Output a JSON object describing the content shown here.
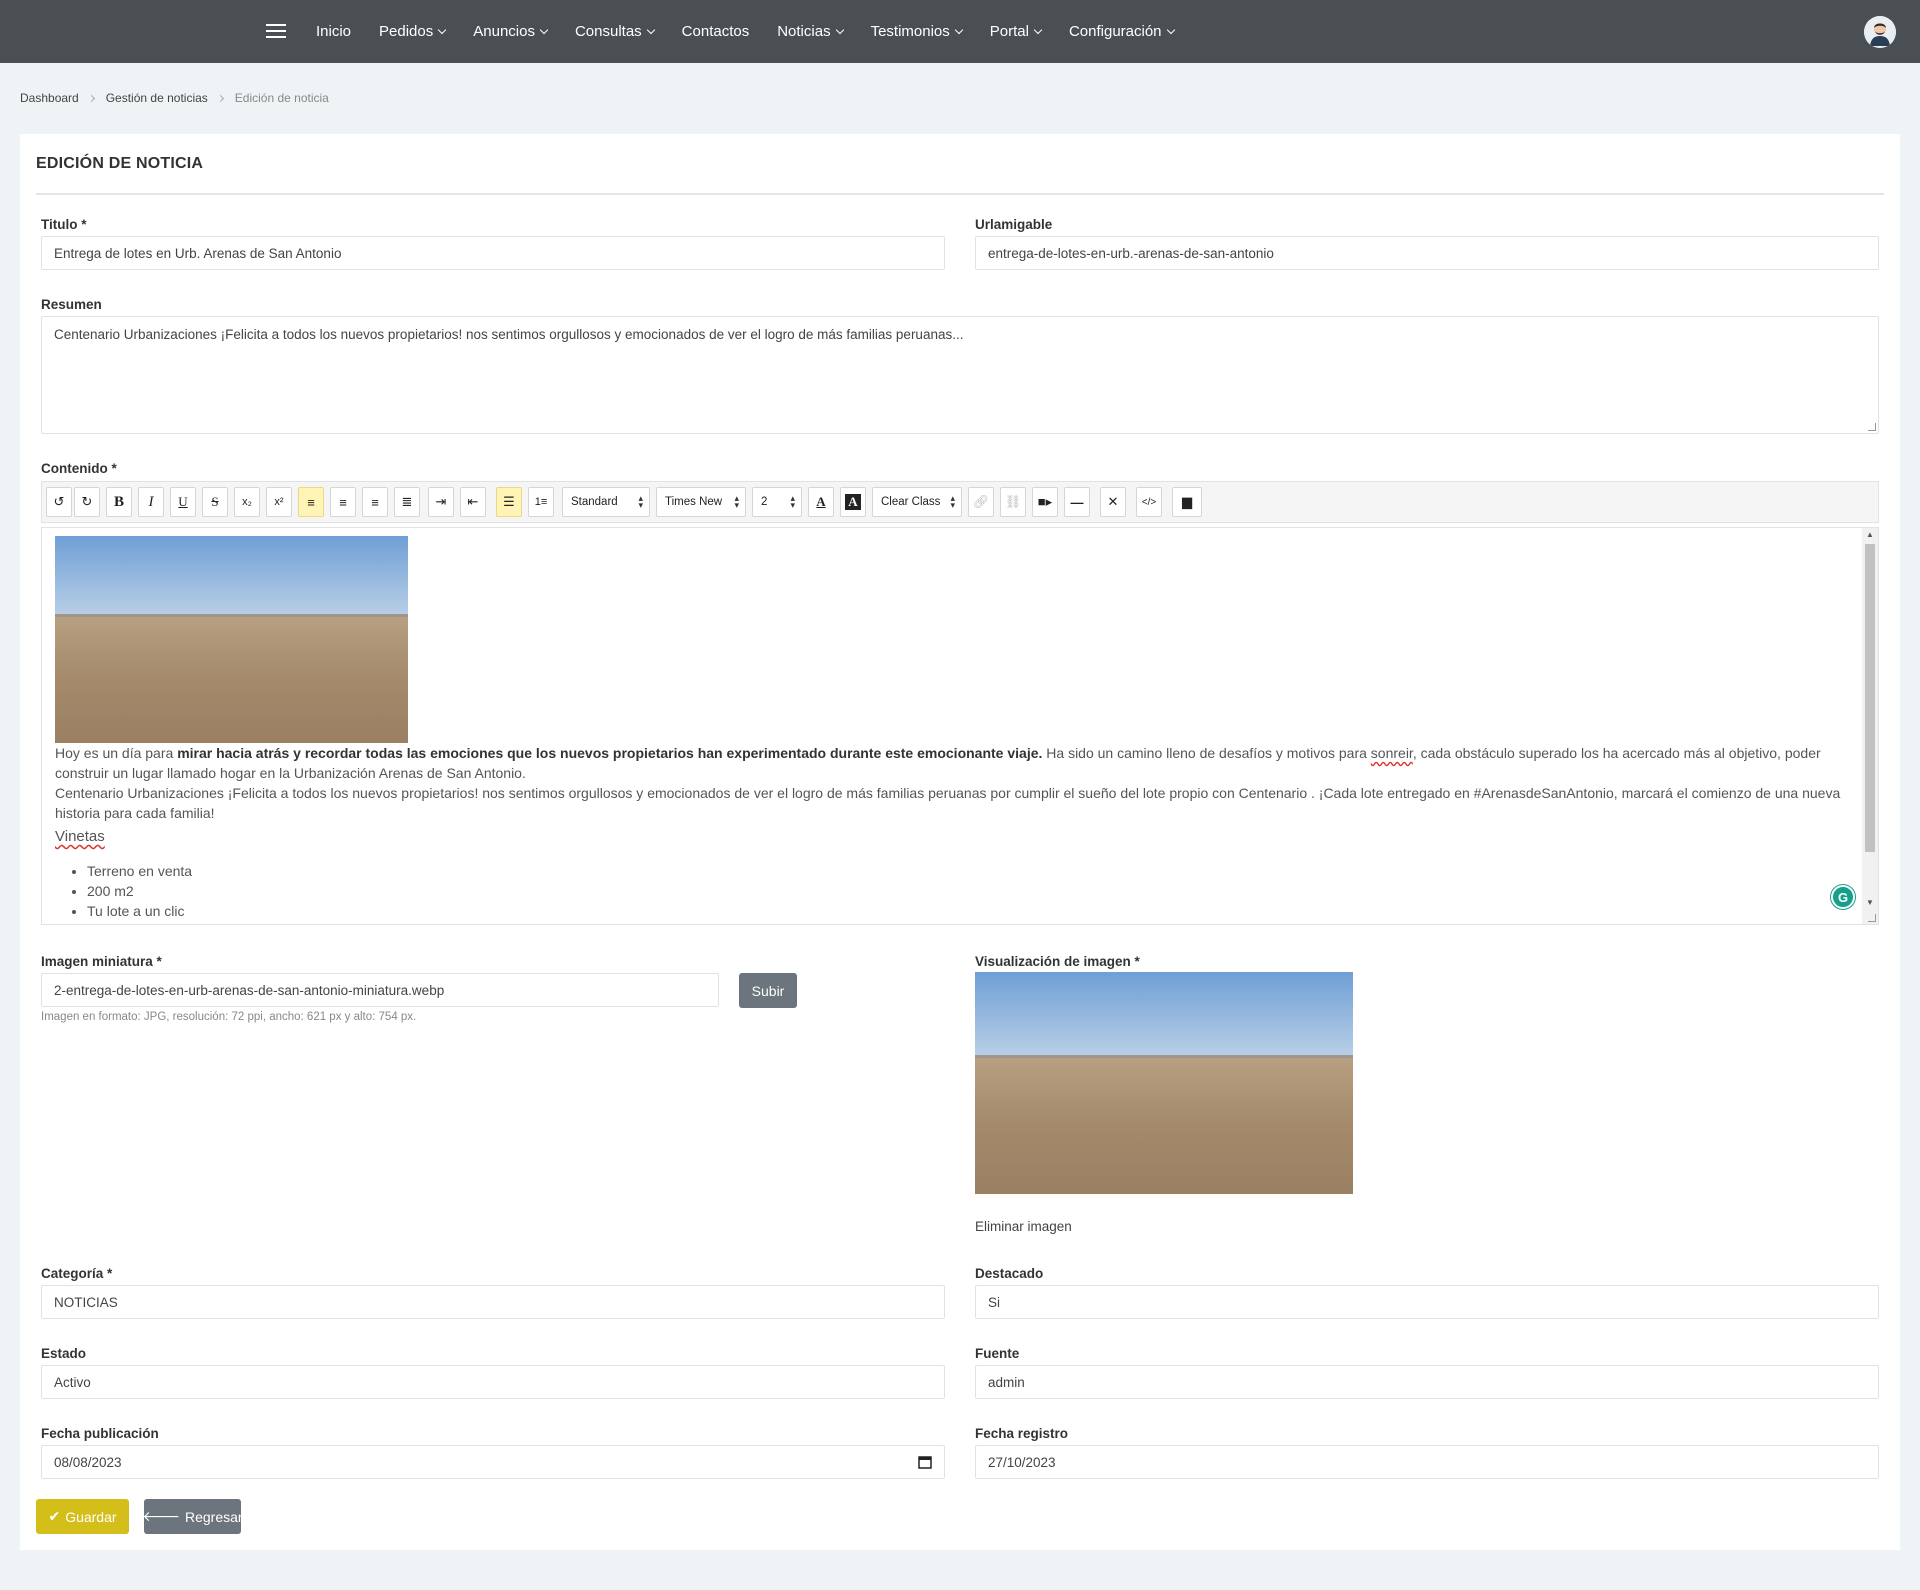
{
  "nav": {
    "items": [
      {
        "label": "Inicio",
        "dropdown": false
      },
      {
        "label": "Pedidos",
        "dropdown": true
      },
      {
        "label": "Anuncios",
        "dropdown": true
      },
      {
        "label": "Consultas",
        "dropdown": true
      },
      {
        "label": "Contactos",
        "dropdown": false
      },
      {
        "label": "Noticias",
        "dropdown": true
      },
      {
        "label": "Testimonios",
        "dropdown": true
      },
      {
        "label": "Portal",
        "dropdown": true
      },
      {
        "label": "Configuración",
        "dropdown": true
      }
    ]
  },
  "breadcrumb": [
    "Dashboard",
    "Gestión de noticias",
    "Edición de noticia"
  ],
  "card": {
    "title": "EDICIÓN DE NOTICIA"
  },
  "form": {
    "titulo": {
      "label": "Titulo *",
      "value": "Entrega de lotes en Urb. Arenas de San Antonio"
    },
    "urlamigable": {
      "label": "Urlamigable",
      "value": "entrega-de-lotes-en-urb.-arenas-de-san-antonio"
    },
    "resumen": {
      "label": "Resumen",
      "value": "Centenario Urbanizaciones ¡Felicita a todos los nuevos propietarios! nos sentimos orgullosos y emocionados de ver el logro de más familias peruanas..."
    },
    "contenido": {
      "label": "Contenido *",
      "toolbar": {
        "style_select": "Standard",
        "font_select": "Times New R",
        "size_select": "2",
        "clear_class": "Clear Class"
      },
      "body": {
        "p1_start": "Hoy es un día para ",
        "p1_bold": "mirar hacia atrás y recordar todas las emociones que los nuevos propietarios han experimentado durante este emocionante viaje.",
        "p1_mid": " Ha sido un camino lleno de desafíos y motivos para ",
        "p1_spell": "sonreir",
        "p1_end": ", cada obstáculo superado los ha acercado más al objetivo, poder construir un lugar llamado hogar en la Urbanización Arenas de San Antonio.",
        "p2": "Centenario Urbanizaciones ¡Felicita a todos los nuevos propietarios! nos sentimos orgullosos y emocionados de ver el logro de más familias peruanas por cumplir el sueño del lote propio con Centenario . ¡Cada lote entregado en #ArenasdeSanAntonio, marcará el comienzo de una nueva historia para cada familia!",
        "heading": "Vinetas",
        "list": [
          "Terreno en venta",
          "200 m2",
          "Tu lote a un clic"
        ]
      }
    },
    "imagen_miniatura": {
      "label": "Imagen miniatura *",
      "value": "2-entrega-de-lotes-en-urb-arenas-de-san-antonio-miniatura.webp",
      "upload_label": "Subir",
      "help": "Imagen en formato: JPG, resolución: 72 ppi, ancho: 621 px y alto: 754 px."
    },
    "visualizacion": {
      "label": "Visualización de imagen *",
      "delete_label": "Eliminar imagen"
    },
    "categoria": {
      "label": "Categoría *",
      "value": "NOTICIAS"
    },
    "destacado": {
      "label": "Destacado",
      "value": "Si"
    },
    "estado": {
      "label": "Estado",
      "value": "Activo"
    },
    "fuente": {
      "label": "Fuente",
      "value": "admin"
    },
    "fecha_publicacion": {
      "label": "Fecha publicación",
      "value": "08/08/2023"
    },
    "fecha_registro": {
      "label": "Fecha registro",
      "value": "27/10/2023"
    }
  },
  "actions": {
    "save": "Guardar",
    "back": "Regresar"
  },
  "colors": {
    "nav_bg": "#4a4f54",
    "save": "#d4be1a",
    "secondary": "#6c757d",
    "active_tool": "#fff3b5"
  }
}
